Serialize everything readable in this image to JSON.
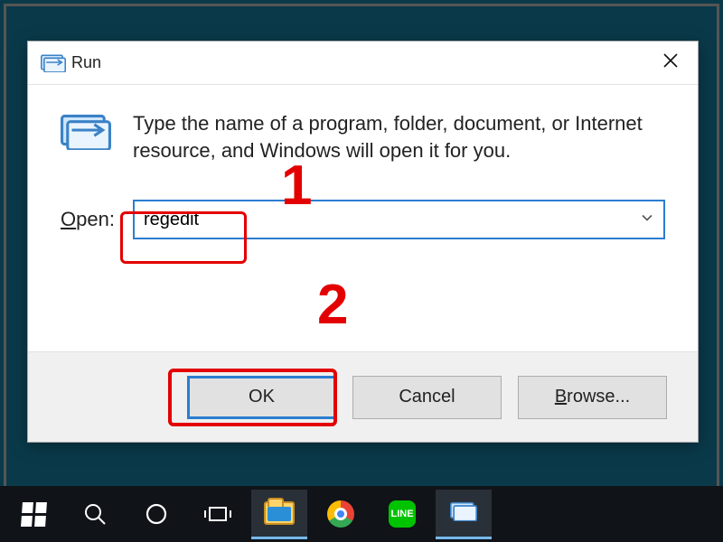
{
  "dialog": {
    "title": "Run",
    "hint": "Type the name of a program, folder, document, or Internet resource, and Windows will open it for you.",
    "openLabel": "Open:",
    "inputValue": "regedit",
    "buttons": {
      "ok": "OK",
      "cancel": "Cancel",
      "browse": "Browse..."
    }
  },
  "annotations": {
    "step1": "1",
    "step2": "2"
  },
  "taskbar": {
    "items": [
      {
        "name": "start"
      },
      {
        "name": "search"
      },
      {
        "name": "cortana"
      },
      {
        "name": "task-view"
      },
      {
        "name": "file-explorer"
      },
      {
        "name": "chrome"
      },
      {
        "name": "line"
      },
      {
        "name": "run"
      }
    ]
  },
  "colors": {
    "accent": "#2b7dd0",
    "annotation": "#e30000"
  }
}
